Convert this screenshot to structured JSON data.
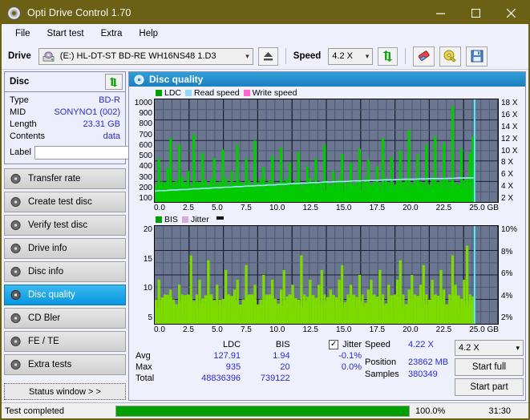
{
  "window": {
    "title": "Opti Drive Control 1.70",
    "minimize": "–",
    "maximize": "□",
    "close": "✕"
  },
  "menu": {
    "items": [
      {
        "label": "File",
        "accel": "F"
      },
      {
        "label": "Start test",
        "accel": "S"
      },
      {
        "label": "Extra",
        "accel": "x"
      },
      {
        "label": "Help",
        "accel": "H"
      }
    ]
  },
  "toolbar": {
    "drive_label": "Drive",
    "drive_value": "(E:)  HL-DT-ST BD-RE  WH16NS48 1.D3",
    "eject_icon": "eject-icon",
    "speed_label": "Speed",
    "speed_value": "4.2 X",
    "refresh_icon": "refresh-icon",
    "erase_icon": "eraser-icon",
    "disc_tools_icon": "gold-disc-icon",
    "save_icon": "save-floppy-icon"
  },
  "disc_panel": {
    "title": "Disc",
    "refresh_icon": "refresh-icon",
    "rows": [
      {
        "key": "Type",
        "value": "BD-R"
      },
      {
        "key": "MID",
        "value": "SONYNO1 (002)"
      },
      {
        "key": "Length",
        "value": "23.31 GB"
      },
      {
        "key": "Contents",
        "value": "data"
      }
    ],
    "label_key": "Label",
    "label_value": "",
    "label_placeholder": "",
    "label_button_icon": "disc-icon"
  },
  "sidebar": {
    "items": [
      {
        "label": "Transfer rate",
        "icon": "disc-icon",
        "active": false
      },
      {
        "label": "Create test disc",
        "icon": "disc-icon",
        "active": false
      },
      {
        "label": "Verify test disc",
        "icon": "disc-icon",
        "active": false
      },
      {
        "label": "Drive info",
        "icon": "disc-icon",
        "active": false
      },
      {
        "label": "Disc info",
        "icon": "disc-icon",
        "active": false
      },
      {
        "label": "Disc quality",
        "icon": "disc-icon",
        "active": true
      },
      {
        "label": "CD Bler",
        "icon": "disc-icon",
        "active": false
      },
      {
        "label": "FE / TE",
        "icon": "disc-icon",
        "active": false
      },
      {
        "label": "Extra tests",
        "icon": "disc-icon",
        "active": false
      }
    ],
    "status_window_button": "Status window > >"
  },
  "main": {
    "title": "Disc quality",
    "title_icon": "disc-quality-icon"
  },
  "stats": {
    "col_headers": [
      "",
      "LDC",
      "BIS",
      "Jitter"
    ],
    "jitter_checkbox_checked": true,
    "jitter_label": "Jitter",
    "rows": [
      {
        "label": "Avg",
        "ldc": "127.91",
        "bis": "1.94",
        "jitter": "-0.1%"
      },
      {
        "label": "Max",
        "ldc": "935",
        "bis": "20",
        "jitter": "0.0%"
      },
      {
        "label": "Total",
        "ldc": "48836396",
        "bis": "739122",
        "jitter": ""
      }
    ],
    "speed_key": "Speed",
    "speed_value": "4.22 X",
    "position_key": "Position",
    "position_value": "23862 MB",
    "samples_key": "Samples",
    "samples_value": "380349",
    "speed_select": "4.2 X",
    "start_full_button": "Start full",
    "start_part_button": "Start part"
  },
  "statusbar": {
    "text": "Test completed",
    "percent": "100.0%",
    "progress": 100,
    "time": "31:30"
  },
  "chart_data": [
    {
      "type": "line",
      "name": "disc-quality-ldc",
      "title": "LDC / Read speed",
      "xlabel": "GB",
      "ylabel": "LDC",
      "legend": [
        {
          "label": "LDC",
          "color": "#00a000"
        },
        {
          "label": "Read speed",
          "color": "#8fd8f5"
        },
        {
          "label": "Write speed",
          "color": "#ff66d0"
        }
      ],
      "legend_position": "top-left",
      "grid": true,
      "x": [
        0.0,
        2.5,
        5.0,
        7.5,
        10.0,
        12.5,
        15.0,
        17.5,
        20.0,
        22.5,
        25.0
      ],
      "xtick_labels": [
        "0.0",
        "2.5",
        "5.0",
        "7.5",
        "10.0",
        "12.5",
        "15.0",
        "17.5",
        "20.0",
        "22.5",
        "25.0 GB"
      ],
      "xlim": [
        0,
        25.0
      ],
      "ylim": [
        0,
        1000
      ],
      "ytick_labels": [
        "1000",
        "900",
        "800",
        "700",
        "600",
        "500",
        "400",
        "300",
        "200",
        "100"
      ],
      "y2_label": "X",
      "y2lim": [
        0,
        18
      ],
      "y2tick_labels": [
        "18 X",
        "16 X",
        "14 X",
        "12 X",
        "10 X",
        "8 X",
        "6 X",
        "4 X",
        "2 X"
      ],
      "series": [
        {
          "name": "LDC",
          "color": "#00cc00",
          "values": [
            170,
            420,
            200,
            190,
            330,
            620,
            190,
            210,
            560,
            240,
            190,
            300,
            170,
            660,
            200,
            190,
            480,
            210,
            170,
            230,
            430,
            180,
            200,
            510,
            230,
            170,
            300,
            190,
            560,
            200,
            180,
            420,
            210,
            170,
            600,
            190,
            230,
            340,
            180,
            210,
            450,
            170,
            190,
            530,
            200,
            230,
            380,
            170,
            210,
            490,
            190,
            170,
            350,
            230,
            200,
            420,
            180,
            190,
            560,
            210,
            170,
            300,
            190,
            230,
            470,
            180,
            200,
            380,
            170,
            210,
            520,
            190,
            230,
            410,
            170,
            200,
            350,
            180,
            620,
            230,
            190,
            440,
            170,
            210,
            500,
            190,
            230,
            700,
            180,
            210,
            460,
            200,
            190,
            560,
            170,
            230,
            640,
            190,
            210,
            580,
            230,
            200,
            935,
            190,
            170,
            520,
            210,
            230,
            480,
            640
          ]
        },
        {
          "name": "Read speed",
          "color": "#9fe8ff",
          "values": [
            1.9,
            2.0,
            2.0,
            2.1,
            2.1,
            2.2,
            2.2,
            2.3,
            2.3,
            2.4,
            2.4,
            2.5,
            2.5,
            2.6,
            2.6,
            2.7,
            2.7,
            2.8,
            2.8,
            2.9,
            2.9,
            3.0,
            3.0,
            3.1,
            3.1,
            3.2,
            3.2,
            3.3,
            3.3,
            3.4,
            3.4,
            3.5,
            3.5,
            3.55,
            3.6,
            3.6,
            3.65,
            3.7,
            3.7,
            3.75,
            3.8,
            3.8,
            3.85,
            3.9,
            3.9,
            3.95,
            4.0,
            4.0,
            4.0,
            4.05,
            4.05,
            4.1,
            4.1,
            4.1,
            4.15,
            4.15,
            4.2,
            4.2,
            4.2,
            4.22
          ]
        }
      ],
      "end_marker_gb": 23.3,
      "end_marker_color": "#55e8ff"
    },
    {
      "type": "bar",
      "name": "disc-quality-bis",
      "title": "BIS / Jitter",
      "xlabel": "GB",
      "ylabel": "BIS",
      "legend": [
        {
          "label": "BIS",
          "color": "#00a000"
        },
        {
          "label": "Jitter",
          "color": "#d9a8e0"
        }
      ],
      "legend_position": "top-left",
      "grid": true,
      "xtick_labels": [
        "0.0",
        "2.5",
        "5.0",
        "7.5",
        "10.0",
        "12.5",
        "15.0",
        "17.5",
        "20.0",
        "22.5",
        "25.0 GB"
      ],
      "xlim": [
        0,
        25.0
      ],
      "ylim": [
        0,
        20
      ],
      "ytick_labels": [
        "20",
        "15",
        "10",
        "5"
      ],
      "y2_label": "%",
      "y2lim": [
        0,
        10
      ],
      "y2tick_labels": [
        "10%",
        "8%",
        "6%",
        "4%",
        "2%"
      ],
      "series": [
        {
          "name": "BIS",
          "color": "#7ddb00",
          "values": [
            5,
            9,
            4,
            6,
            3,
            7,
            5,
            4,
            8,
            6,
            3,
            5,
            14,
            4,
            6,
            9,
            3,
            5,
            13,
            6,
            4,
            8,
            5,
            3,
            11,
            6,
            4,
            7,
            9,
            3,
            5,
            12,
            4,
            6,
            8,
            3,
            5,
            10,
            6,
            4,
            9,
            5,
            3,
            7,
            11,
            4,
            6,
            8,
            3,
            5,
            14,
            6,
            4,
            9,
            5,
            3,
            8,
            11,
            6,
            4,
            7,
            5,
            3,
            9,
            12,
            4,
            6,
            8,
            5,
            3,
            10,
            6,
            4,
            7,
            9,
            3,
            5,
            11,
            6,
            4,
            8,
            5,
            3,
            9,
            13,
            6,
            4,
            7,
            10,
            5,
            3,
            8,
            12,
            6,
            4,
            9,
            5,
            3,
            11,
            7,
            4,
            6,
            14,
            8,
            5,
            3,
            9,
            16,
            6,
            4
          ]
        }
      ],
      "end_marker_gb": 23.3,
      "end_marker_color": "#55e8ff"
    }
  ]
}
